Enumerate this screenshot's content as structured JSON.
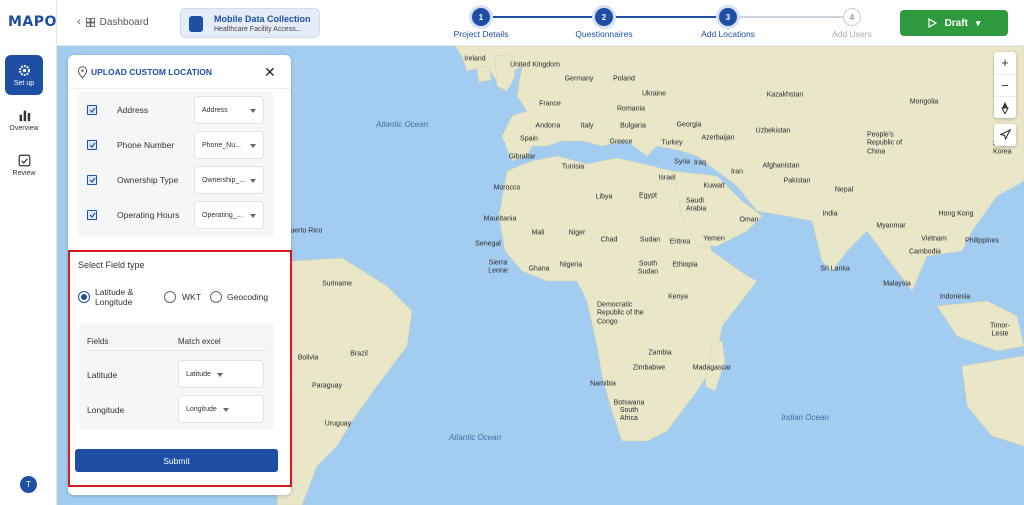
{
  "logo": "MAPOG",
  "sidebar": {
    "items": [
      {
        "label": "Set up",
        "icon": "gear-icon"
      },
      {
        "label": "Overview",
        "icon": "bar-chart-icon"
      },
      {
        "label": "Review",
        "icon": "checkbox-icon"
      }
    ],
    "avatar": "T"
  },
  "header": {
    "dashboard": "Dashboard",
    "project_title": "Mobile Data Collection",
    "project_subtitle": "Healthcare Facility Access...",
    "draft_label": "Draft",
    "steps": [
      {
        "num": "1",
        "label": "Project Details",
        "state": "done"
      },
      {
        "num": "2",
        "label": "Questionnaires",
        "state": "done"
      },
      {
        "num": "3",
        "label": "Add Locations",
        "state": "active"
      },
      {
        "num": "4",
        "label": "Add Users",
        "state": "todo"
      }
    ]
  },
  "panel": {
    "title": "UPLOAD CUSTOM LOCATION",
    "field_rows": [
      {
        "label": "Address",
        "value": "Address"
      },
      {
        "label": "Phone Number",
        "value": "Phone_Nu..."
      },
      {
        "label": "Ownership Type",
        "value": "Ownership_..."
      },
      {
        "label": "Operating Hours",
        "value": "Operating_..."
      }
    ],
    "field_type_label": "Select Field type",
    "options": [
      "Latitude & Longitude",
      "WKT",
      "Geocoding"
    ],
    "selected_option": "Latitude & Longitude",
    "col_fields": "Fields",
    "col_match": "Match excel",
    "mappings": [
      {
        "field": "Latitude",
        "value": "Latitude"
      },
      {
        "field": "Longitude",
        "value": "Longitude"
      }
    ],
    "submit": "Submit"
  },
  "map": {
    "labels": [
      "Ireland",
      "United Kingdom",
      "Germany",
      "Poland",
      "Ukraine",
      "Kazakhstan",
      "Mongolia",
      "France",
      "Romania",
      "Andorra",
      "Italy",
      "Bulgaria",
      "Georgia",
      "Uzbekistan",
      "People's Republic of China",
      "Spain",
      "Greece",
      "Turkey",
      "Azerbaijan",
      "Gibraltar",
      "Syria",
      "Afghanistan",
      "South Korea",
      "Tunisia",
      "Iraq",
      "Iran",
      "Morocco",
      "Israel",
      "Kuwait",
      "Pakistan",
      "Nepal",
      "Libya",
      "Egypt",
      "Saudi Arabia",
      "Oman",
      "India",
      "Hong Kong",
      "Mauritania",
      "Mali",
      "Niger",
      "Chad",
      "Sudan",
      "Eritrea",
      "Yemen",
      "Myanmar",
      "Senegal",
      "Nigeria",
      "Ethiopia",
      "South Sudan",
      "Vietnam",
      "Cambodia",
      "Philippines",
      "Sierra Leone",
      "Ghana",
      "Sri Lanka",
      "Suriname",
      "Democratic Republic of the Congo",
      "Kenya",
      "Malaysia",
      "Indonesia",
      "Brazil",
      "Timor-Leste",
      "Bolivia",
      "Zambia",
      "Paraguay",
      "Zimbabwe",
      "Madagascar",
      "Namibia",
      "Botswana",
      "South Africa",
      "Uruguay",
      "Puerto Rico"
    ],
    "oceans": [
      "Atlantic Ocean",
      "Indian Ocean"
    ],
    "controls": [
      "zoom-in",
      "zoom-out",
      "compass",
      "locate"
    ]
  },
  "colors": {
    "primary": "#1e4fa5",
    "draft": "#2e9a3d",
    "highlight": "#d51c1c",
    "ocean": "#a3cdf0",
    "land": "#e9e7c8"
  }
}
